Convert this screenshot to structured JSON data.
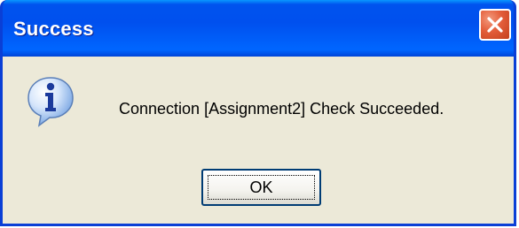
{
  "window": {
    "title": "Success",
    "close_icon": "close-icon"
  },
  "dialog": {
    "icon": "info-icon",
    "message": "Connection [Assignment2] Check Succeeded.",
    "ok_label": "OK"
  },
  "colors": {
    "titlebar": "#0054e3",
    "client": "#ece9d8",
    "close_button": "#e35d3a"
  }
}
